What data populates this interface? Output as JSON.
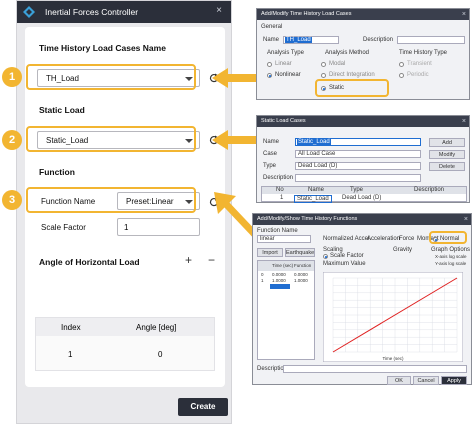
{
  "panel": {
    "title": "Inertial Forces Controller",
    "close_glyph": "×",
    "sections": {
      "time_history": "Time History Load Cases Name",
      "static_load": "Static Load",
      "function": "Function",
      "angle": "Angle of Horizontal Load"
    },
    "time_history_value": "TH_Load",
    "static_load_value": "Static_Load",
    "function_name_label": "Function Name",
    "function_name_value": "Preset:Linear",
    "scale_factor_label": "Scale Factor",
    "scale_factor_value": "1",
    "add_glyph": "+",
    "remove_glyph": "−",
    "table": {
      "headers": [
        "Index",
        "Angle [deg]"
      ],
      "rows": [
        [
          "1",
          "0"
        ]
      ]
    },
    "create_label": "Create",
    "markers": [
      "1",
      "2",
      "3"
    ]
  },
  "dialog1": {
    "title": "Add/Modify Time History Load Cases",
    "general": "General",
    "name_label": "Name",
    "name_value": "TH_Load",
    "description_label": "Description",
    "analysis_type": "Analysis Type",
    "linear": "Linear",
    "nonlinear": "Nonlinear",
    "analysis_method": "Analysis Method",
    "modal": "Modal",
    "direct_integration": "Direct Integration",
    "static": "Static",
    "th_type": "Time History Type",
    "transient": "Transient",
    "periodic": "Periodic"
  },
  "dialog2": {
    "title": "Static Load Cases",
    "name_label": "Name",
    "name_value": "Static_Load",
    "case_label": "Case",
    "case_value": "All Load Case",
    "type_label": "Type",
    "type_value": "Dead Load (D)",
    "description_label": "Description",
    "add": "Add",
    "modify": "Modify",
    "delete": "Delete",
    "headers": [
      "No",
      "Name",
      "Type",
      "Description"
    ],
    "row": [
      "1",
      "Static_Load",
      "Dead Load (D)",
      ""
    ]
  },
  "dialog3": {
    "title": "Add/Modify/Show Time History Functions",
    "function_name": "Function Name",
    "function_name_value": "linear",
    "import": "Import",
    "earthquake": "Earthquake",
    "col_time": "Time (sec)",
    "col_function": "Function",
    "rows": [
      [
        "0",
        "0.0000",
        "0.0000"
      ],
      [
        "1",
        "1.0000",
        "1.0000"
      ]
    ],
    "scaling": "Scaling",
    "scale_factor": "Scale Factor",
    "max_value": "Maximum Value",
    "normalized_accel": "Normalized Accel.",
    "acceleration": "Acceleration",
    "force": "Force",
    "moment": "Moment",
    "normal": "Normal",
    "gravity": "Gravity",
    "graph_options": "Graph Options",
    "x_axis_log": "X-axis log scale",
    "y_axis_log": "Y-axis log scale",
    "time_axis": "Time (sec)",
    "description": "Description",
    "ok": "OK",
    "cancel": "Cancel",
    "apply": "Apply"
  },
  "colors": {
    "highlight": "#f2b531",
    "titlebar": "#2b2f3a",
    "plot_line": "#e02020"
  },
  "chart_data": {
    "type": "line",
    "x": [
      0,
      1
    ],
    "series": [
      {
        "values": [
          0,
          1
        ]
      }
    ],
    "xlabel": "Time (sec)"
  }
}
